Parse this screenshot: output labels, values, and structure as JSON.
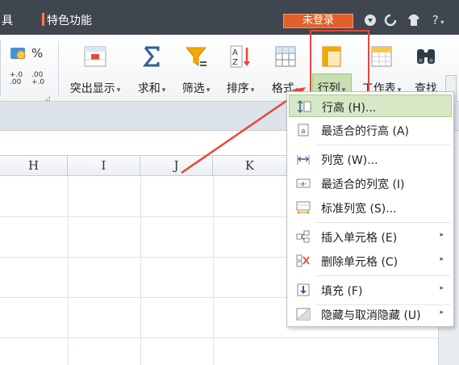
{
  "titlebar": {
    "menu_left": "具",
    "special": "特色功能",
    "login": "未登录",
    "help": "?"
  },
  "ribbon": {
    "numfmt": {
      "percent": "%",
      "inc": "+.0\n.00",
      "dec": ".00\n+.0"
    },
    "buttons": [
      {
        "label": "突出显示",
        "icon": "highlight-icon"
      },
      {
        "label": "求和",
        "icon": "sigma-icon"
      },
      {
        "label": "筛选",
        "icon": "filter-icon"
      },
      {
        "label": "排序",
        "icon": "sort-icon"
      },
      {
        "label": "格式",
        "icon": "format-icon"
      },
      {
        "label": "行列",
        "icon": "row-col-icon"
      },
      {
        "label": "工作表",
        "icon": "worksheet-icon"
      },
      {
        "label": "查找",
        "icon": "find-icon"
      }
    ]
  },
  "sheet": {
    "columns": [
      "H",
      "I",
      "J",
      "K"
    ]
  },
  "menu": {
    "items": [
      {
        "label": "行高 (H)...",
        "icon": "row-height-icon",
        "submenu": false
      },
      {
        "label": "最适合的行高 (A)",
        "icon": "autofit-row-icon",
        "submenu": false
      },
      {
        "label": "列宽 (W)...",
        "icon": "column-width-icon",
        "submenu": false
      },
      {
        "label": "最适合的列宽 (I)",
        "icon": "autofit-column-icon",
        "submenu": false
      },
      {
        "label": "标准列宽 (S)...",
        "icon": "standard-width-icon",
        "submenu": false
      },
      {
        "label": "插入单元格 (E)",
        "icon": "insert-cells-icon",
        "submenu": true
      },
      {
        "label": "删除单元格 (C)",
        "icon": "delete-cells-icon",
        "submenu": true
      },
      {
        "label": "填充 (F)",
        "icon": "fill-icon",
        "submenu": true
      },
      {
        "label": "隐藏与取消隐藏 (U)",
        "icon": "hide-unhide-icon",
        "submenu": true
      }
    ]
  },
  "colors": {
    "accent_red": "#e8463a",
    "selected_green": "#c7dfb2",
    "titlebar": "#3f4650",
    "login_orange": "#e0612a"
  }
}
